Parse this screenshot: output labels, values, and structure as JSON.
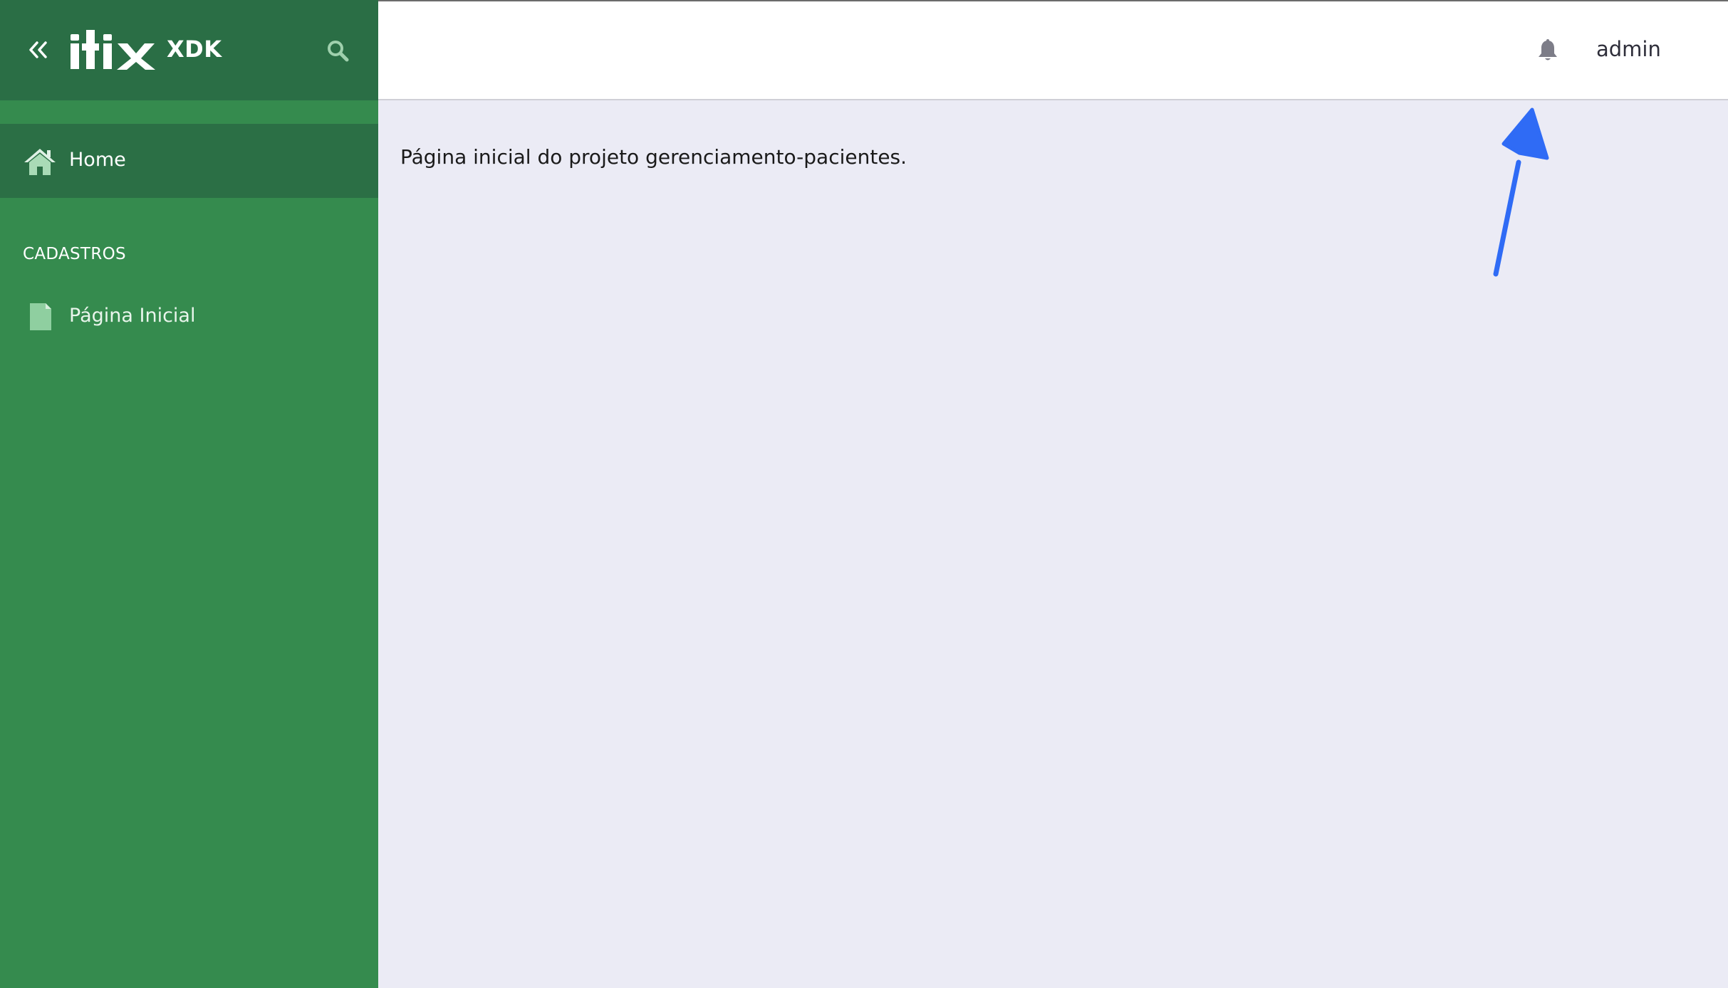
{
  "brand": {
    "logo_text": "itix",
    "suffix": "XDK"
  },
  "sidebar": {
    "collapse_icon": "double-chevron-left-icon",
    "search_icon": "search-icon",
    "home": {
      "label": "Home",
      "icon": "home-icon"
    },
    "section_title": "CADASTROS",
    "items": [
      {
        "label": "Página Inicial",
        "icon": "file-icon"
      }
    ]
  },
  "topbar": {
    "notification_icon": "bell-icon",
    "user_label": "admin"
  },
  "main": {
    "text": "Página inicial do projeto gerenciamento-pacientes."
  },
  "annotation": {
    "arrow_color": "#2f6bf5",
    "target": "bell-icon"
  },
  "colors": {
    "sidebar": "#358b4e",
    "sidebar_header": "#2a6e45",
    "active_item": "#2b6f45",
    "content_background": "#ebebf5",
    "topbar": "#ffffff"
  }
}
